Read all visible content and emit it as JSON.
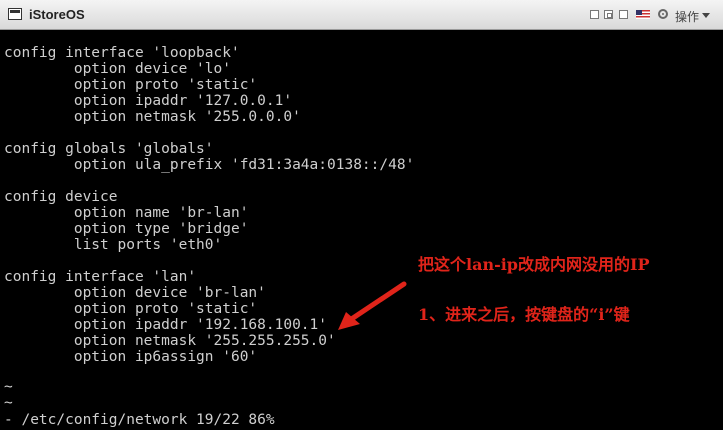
{
  "window": {
    "title": "iStoreOS",
    "op_label": "操作",
    "flag": "us-flag-icon"
  },
  "colors": {
    "terminal_bg": "#000000",
    "terminal_fg": "#cfcfcf",
    "annotation": "#e0241a"
  },
  "terminal": {
    "lines": [
      "config interface 'loopback'",
      "        option device 'lo'",
      "        option proto 'static'",
      "        option ipaddr '127.0.0.1'",
      "        option netmask '255.0.0.0'",
      "",
      "config globals 'globals'",
      "        option ula_prefix 'fd31:3a4a:0138::/48'",
      "",
      "config device",
      "        option name 'br-lan'",
      "        option type 'bridge'",
      "        list ports 'eth0'",
      "",
      "config interface 'lan'",
      "        option device 'br-lan'",
      "        option proto 'static'",
      "        option ipaddr '192.168.100.1'",
      "        option netmask '255.255.255.0'",
      "        option ip6assign '60'",
      "",
      "~",
      "~"
    ],
    "cursor_line": "        option ipaddr '192.168.100.1'",
    "status": "- /etc/config/network 19/22 86%"
  },
  "annotations": {
    "note1": "把这个lan-ip改成内网没用的IP",
    "note2": "1、进来之后，按键盘的“i”键"
  }
}
